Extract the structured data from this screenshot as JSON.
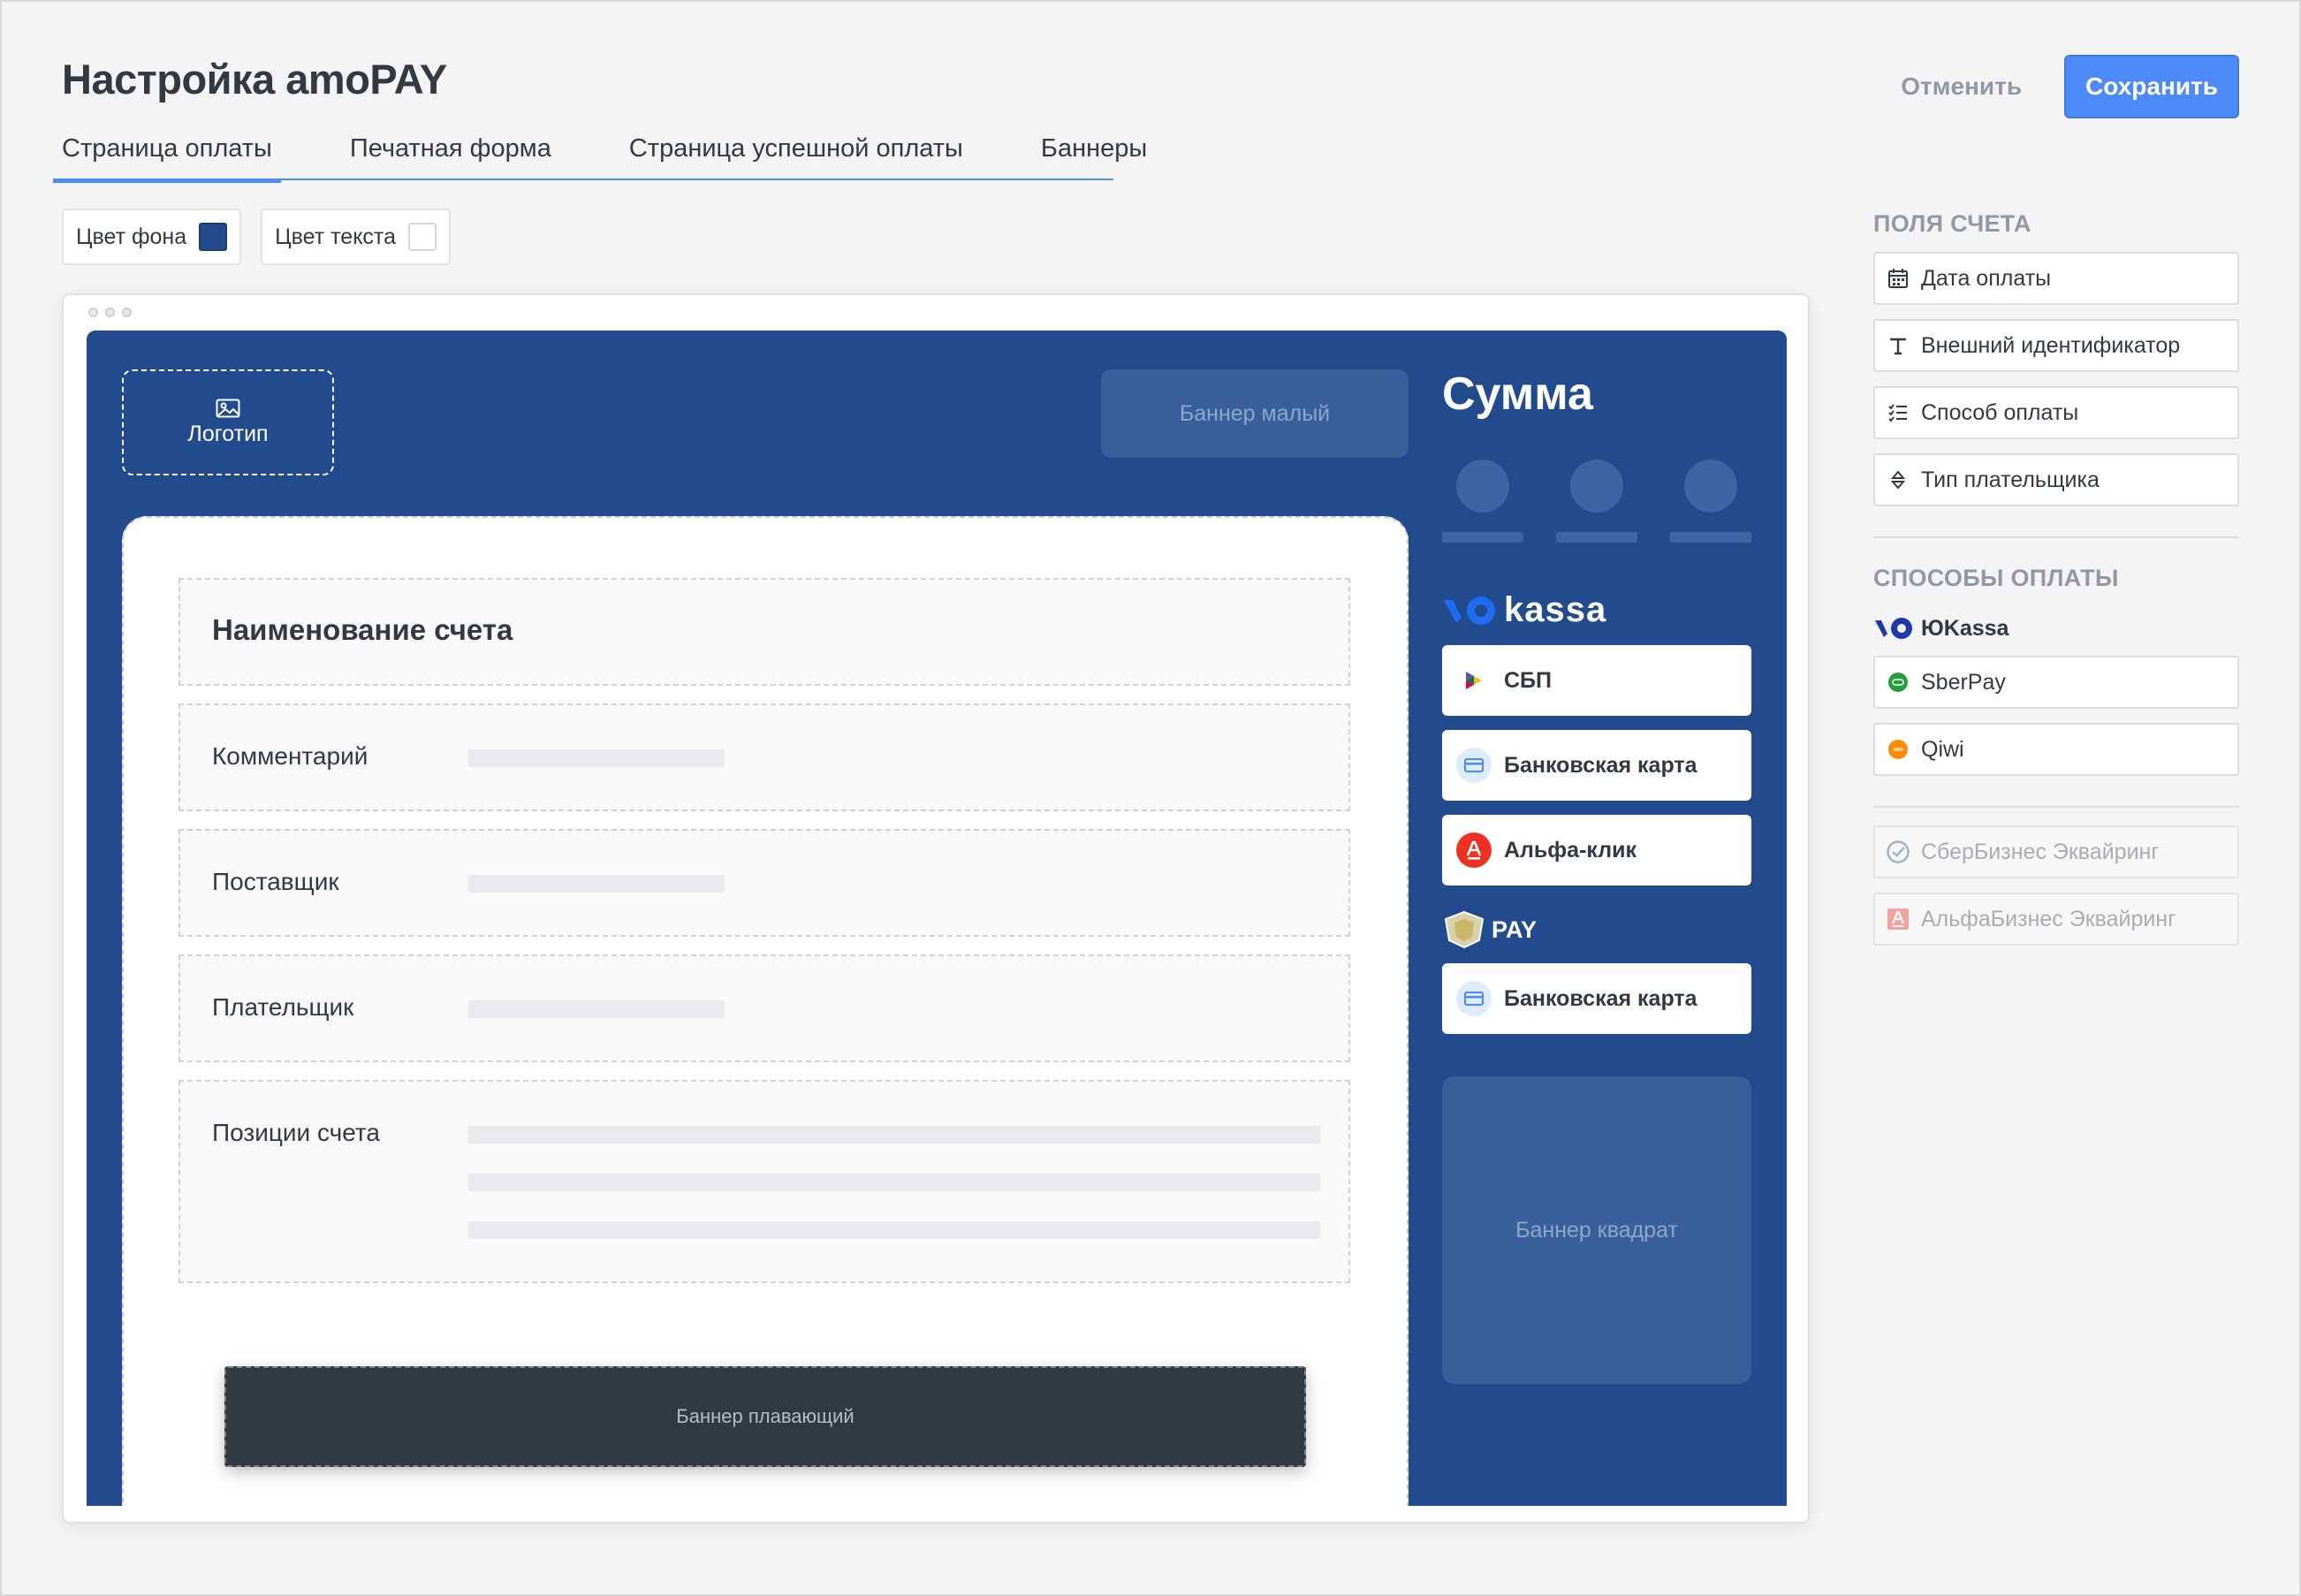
{
  "header": {
    "title": "Настройка amoPAY",
    "cancel_label": "Отменить",
    "save_label": "Сохранить"
  },
  "tabs": [
    {
      "label": "Страница оплаты",
      "active": true
    },
    {
      "label": "Печатная форма",
      "active": false
    },
    {
      "label": "Страница успешной оплаты",
      "active": false
    },
    {
      "label": "Баннеры",
      "active": false
    }
  ],
  "color_pickers": {
    "bg_label": "Цвет фона",
    "bg_color": "#224b8d",
    "text_label": "Цвет текста",
    "text_color": "#ffffff"
  },
  "preview": {
    "logo_label": "Логотип",
    "banner_small": "Баннер малый",
    "invoice_title": "Наименование счета",
    "comment_label": "Комментарий",
    "supplier_label": "Поставщик",
    "payer_label": "Плательщик",
    "items_label": "Позиции счета",
    "banner_floating": "Баннер плавающий",
    "amount_label": "Сумма",
    "kassa_label": "kassa",
    "yookassa_methods": [
      {
        "label": "СБП",
        "icon": "sbp-icon"
      },
      {
        "label": "Банковская карта",
        "icon": "card-icon"
      },
      {
        "label": "Альфа-клик",
        "icon": "alfa-icon"
      }
    ],
    "tinkoff_label": "PAY",
    "tinkoff_methods": [
      {
        "label": "Банковская карта",
        "icon": "card-icon"
      }
    ],
    "banner_square": "Баннер квадрат"
  },
  "sidebar": {
    "fields_heading": "Поля счета",
    "fields": [
      {
        "label": "Дата оплаты",
        "icon": "calendar-icon"
      },
      {
        "label": "Внешний идентификатор",
        "icon": "text-icon"
      },
      {
        "label": "Способ оплаты",
        "icon": "checklist-icon"
      },
      {
        "label": "Тип плательщика",
        "icon": "sort-icon"
      }
    ],
    "methods_heading": "Способы оплаты",
    "yookassa_label": "ЮKassa",
    "methods": [
      {
        "label": "SberPay",
        "icon": "sberpay-icon"
      },
      {
        "label": "Qiwi",
        "icon": "qiwi-icon"
      }
    ],
    "disabled_methods": [
      {
        "label": "СберБизнес Эквайринг",
        "icon": "sber-icon"
      },
      {
        "label": "АльфаБизнес Эквайринг",
        "icon": "alfa-icon"
      }
    ]
  },
  "colors": {
    "accent": "#4c8bf7",
    "pay_background": "#224b8d",
    "text": "#313942"
  }
}
